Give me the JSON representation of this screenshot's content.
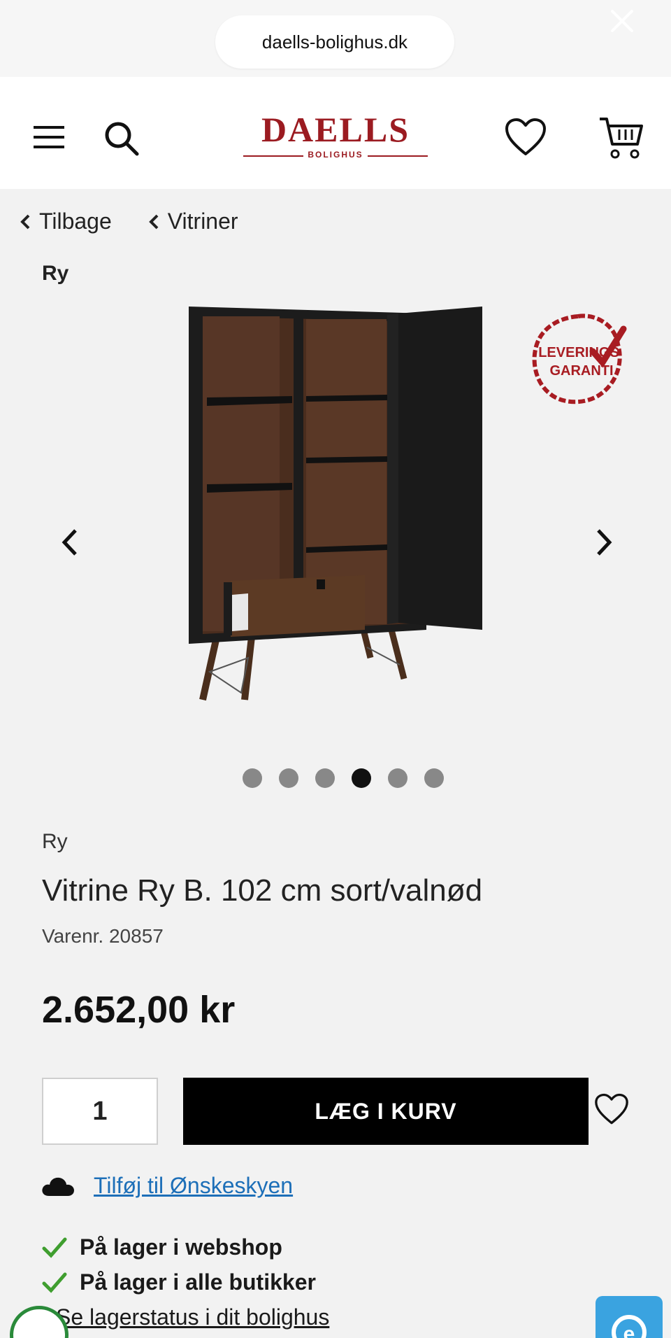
{
  "browser": {
    "url": "daells-bolighus.dk"
  },
  "header": {
    "logo_main": "DAELLS",
    "logo_sub": "BOLIGHUS",
    "brand_color": "#9b1b21",
    "icons": [
      "menu-icon",
      "search-icon",
      "heart-icon",
      "cart-icon"
    ]
  },
  "breadcrumbs": {
    "back": "Tilbage",
    "category": "Vitriner"
  },
  "brand_label_top": "Ry",
  "gallery": {
    "badge_line1": "LEVERINGS",
    "badge_line2": "GARANTI",
    "slide_count": 6,
    "active_index": 3
  },
  "product": {
    "brand": "Ry",
    "title": "Vitrine Ry B. 102 cm sort/valnød",
    "sku": "Varenr. 20857",
    "price": "2.652,00 kr",
    "quantity": "1",
    "add_to_cart": "LÆG I KURV",
    "wishlist_link": "Tilføj til Ønskeskyen"
  },
  "stock": {
    "webshop": "På lager i webshop",
    "stores": "På lager i alle butikker",
    "local_link": "Se lagerstatus i dit bolighus"
  },
  "colors": {
    "check": "#3f9e2f",
    "link": "#1d6fb8",
    "button": "#000000"
  }
}
